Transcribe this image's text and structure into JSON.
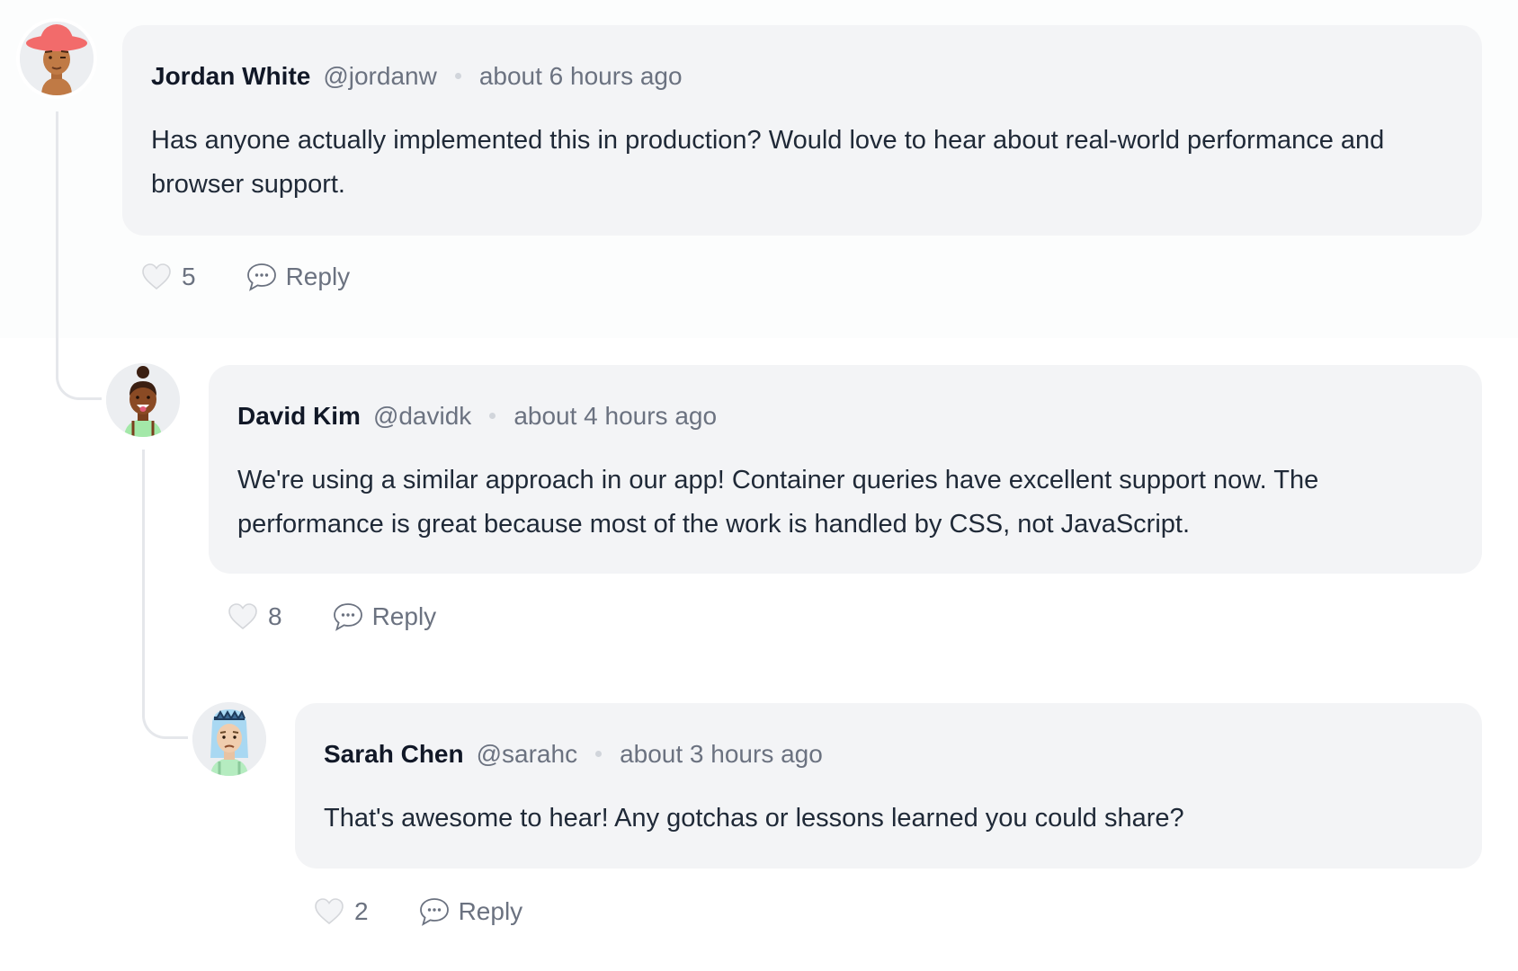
{
  "comments": [
    {
      "author": "Jordan White",
      "handle": "@jordanw",
      "time": "about 6 hours ago",
      "text": "Has anyone actually implemented this in production? Would love to hear about real-world performance and browser support.",
      "likes": "5",
      "reply_label": "Reply",
      "avatar": "avatar-red-hat"
    },
    {
      "author": "David Kim",
      "handle": "@davidk",
      "time": "about 4 hours ago",
      "text": "We're using a similar approach in our app! Container queries have excellent support now. The performance is great because most of the work is handled by CSS, not JavaScript.",
      "likes": "8",
      "reply_label": "Reply",
      "avatar": "avatar-hair-bun"
    },
    {
      "author": "Sarah Chen",
      "handle": "@sarahc",
      "time": "about 3 hours ago",
      "text": "That's awesome to hear! Any gotchas or lessons learned you could share?",
      "likes": "2",
      "reply_label": "Reply",
      "avatar": "avatar-blue-hair"
    }
  ],
  "icons": {
    "like": "heart-icon",
    "reply": "chat-bubble-icon"
  }
}
